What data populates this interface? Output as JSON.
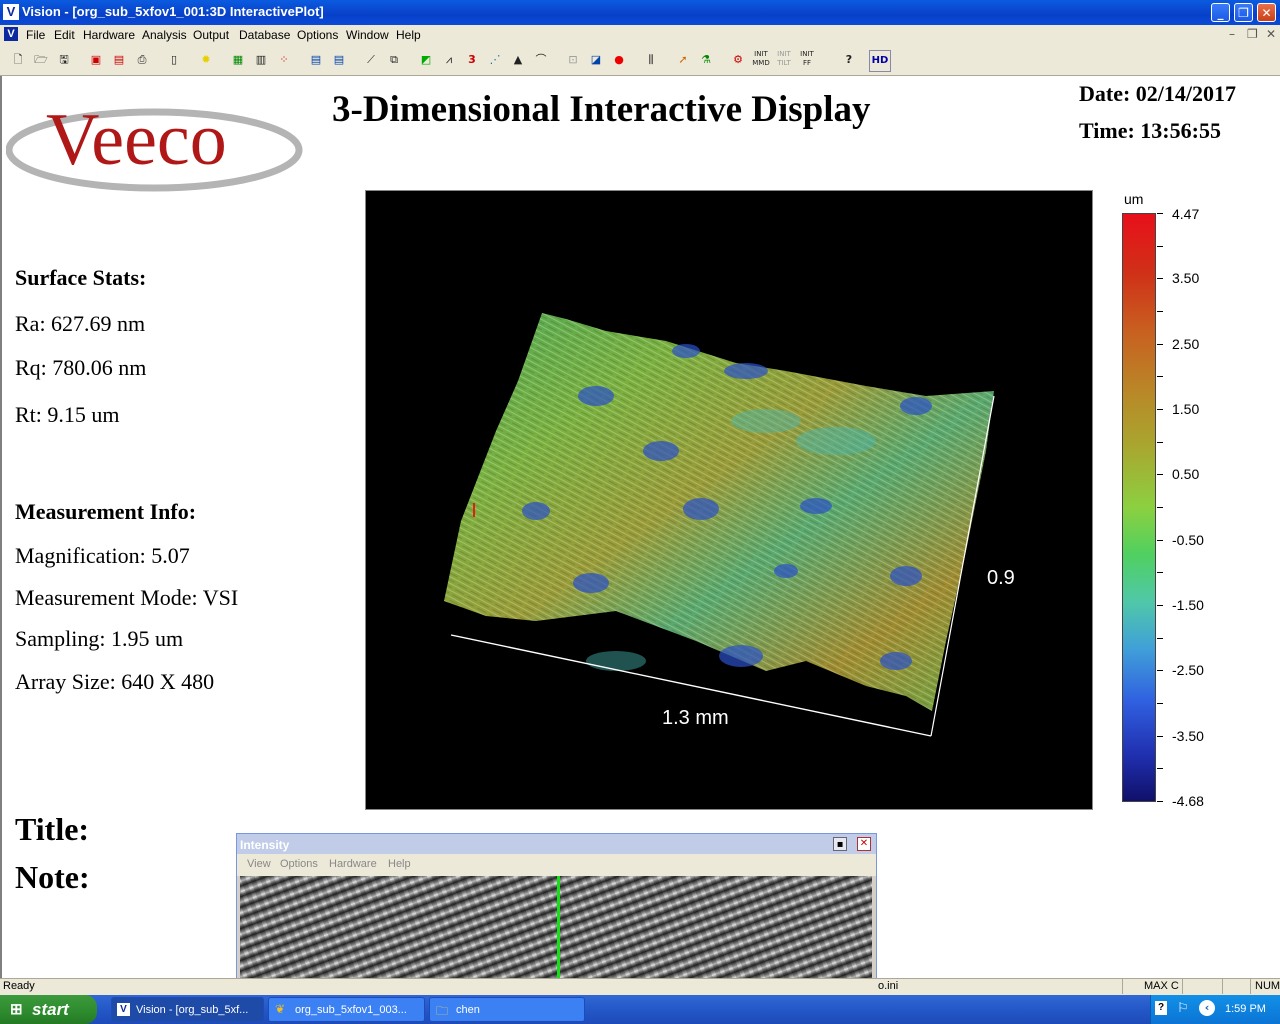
{
  "window": {
    "title": "Vision - [org_sub_5xfov1_001:3D InteractivePlot]",
    "app_icon_letter": "V"
  },
  "menu": {
    "items": [
      "File",
      "Edit",
      "Hardware",
      "Analysis",
      "Output",
      "Database",
      "Options",
      "Window",
      "Help"
    ]
  },
  "toolbar": {
    "hd_label": "HD",
    "help_label": "?",
    "icons": [
      "new-icon",
      "open-icon",
      "save-icon",
      "print-setup-icon",
      "report-icon",
      "print-icon",
      "page-icon",
      "light-icon",
      "color-map-icon",
      "data-icon",
      "stats-icon",
      "contour-icon",
      "profile-icon",
      "measure-icon",
      "copy-icon",
      "image-icon",
      "histogram-icon",
      "3d-icon",
      "stitch-icon",
      "peak-icon",
      "curve-icon",
      "mask-icon",
      "tilt-icon",
      "record-icon",
      "filter-icon",
      "cursor-icon",
      "plot-icon",
      "init-icon",
      "init-mmd-icon",
      "init-tilt-icon",
      "init-ff-icon",
      "help-icon",
      "hd-icon"
    ]
  },
  "header": {
    "brand": "Veeco",
    "title": "3-Dimensional Interactive Display",
    "date_label": "Date: 02/14/2017",
    "time_label": "Time: 13:56:55"
  },
  "stats": {
    "heading": "Surface Stats:",
    "ra": "Ra: 627.69 nm",
    "rq": "Rq: 780.06 nm",
    "rt": "Rt: 9.15 um"
  },
  "measurement": {
    "heading": "Measurement Info:",
    "magnification": "Magnification: 5.07",
    "mode": "Measurement Mode: VSI",
    "sampling": "Sampling: 1.95 um",
    "array_size": "Array Size: 640 X 480"
  },
  "notes": {
    "title_label": "Title:",
    "note_label": "Note:"
  },
  "plot": {
    "x_axis_label": "1.3 mm",
    "y_axis_label": "0.9"
  },
  "color_scale": {
    "unit": "um",
    "ticks": [
      "4.47",
      "3.50",
      "2.50",
      "1.50",
      "0.50",
      "-0.50",
      "-1.50",
      "-2.50",
      "-3.50",
      "-4.68"
    ]
  },
  "intensity_window": {
    "title": "Intensity",
    "menu": [
      "View",
      "Options",
      "Hardware",
      "Help"
    ]
  },
  "statusbar": {
    "status": "Ready",
    "ini_text": "o.ini",
    "max_label": "MAX C",
    "num_label": "NUM"
  },
  "taskbar": {
    "start_label": "start",
    "tasks": [
      "Vision - [org_sub_5xf...",
      "org_sub_5xfov1_003...",
      "chen"
    ],
    "clock": "1:59 PM"
  }
}
